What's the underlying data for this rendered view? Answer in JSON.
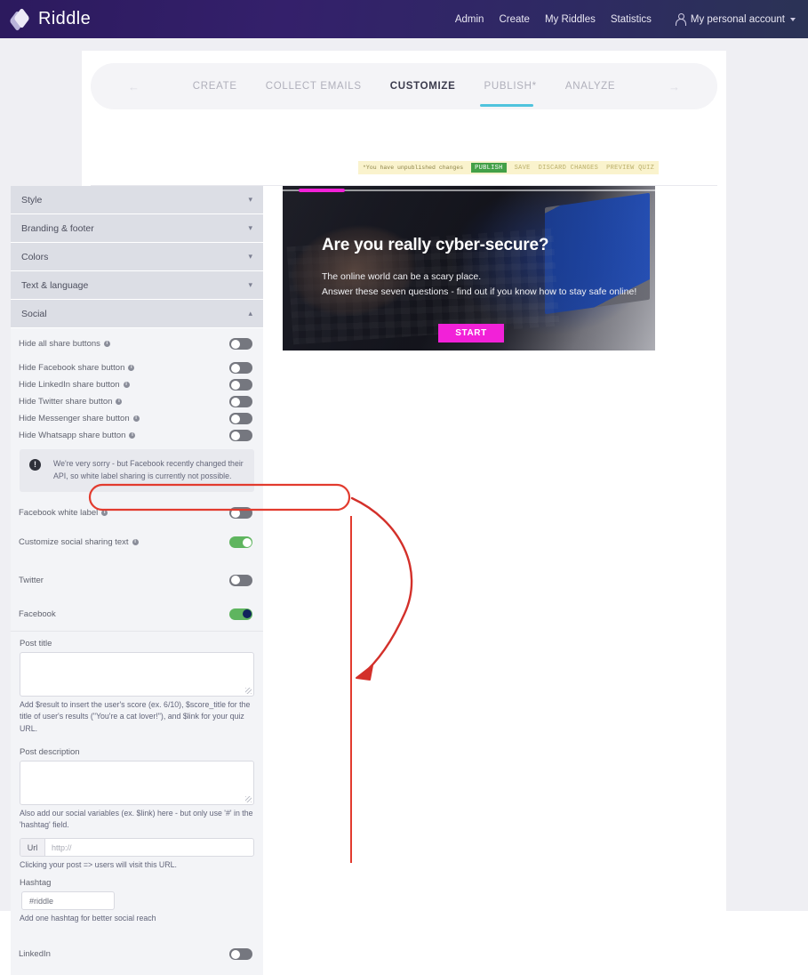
{
  "header": {
    "brand": "Riddle",
    "logo_icon": "riddle-diamond-logo",
    "nav": [
      "Admin",
      "Create",
      "My Riddles",
      "Statistics"
    ],
    "account_label": "My personal account",
    "account_icon": "person-icon",
    "account_caret_icon": "chevron-down-icon"
  },
  "tabs": {
    "prev_icon": "arrow-left-icon",
    "next_icon": "arrow-right-icon",
    "items": [
      {
        "label": "CREATE",
        "active": false
      },
      {
        "label": "COLLECT EMAILS",
        "active": false
      },
      {
        "label": "CUSTOMIZE",
        "active": true
      },
      {
        "label": "PUBLISH*",
        "active": false
      },
      {
        "label": "ANALYZE",
        "active": false
      }
    ],
    "active_underline_color": "#4fc3dd"
  },
  "publish_bar": {
    "warning": "*You have unpublished changes",
    "publish_label": "PUBLISH",
    "publish_color": "#43a047",
    "actions": [
      "SAVE",
      "DISCARD CHANGES",
      "PREVIEW QUIZ"
    ]
  },
  "accordion": [
    {
      "label": "Style",
      "expanded": false,
      "chevron": "chevron-down-icon"
    },
    {
      "label": "Branding & footer",
      "expanded": false,
      "chevron": "chevron-down-icon"
    },
    {
      "label": "Colors",
      "expanded": false,
      "chevron": "chevron-down-icon"
    },
    {
      "label": "Text & language",
      "expanded": false,
      "chevron": "chevron-down-icon"
    },
    {
      "label": "Social",
      "expanded": true,
      "chevron": "chevron-up-icon"
    }
  ],
  "social": {
    "hide_toggles": [
      {
        "label": "Hide all share buttons",
        "on": false,
        "info_icon": "info-icon"
      },
      {
        "label": "Hide Facebook share button",
        "on": false,
        "info_icon": "info-icon"
      },
      {
        "label": "Hide LinkedIn share button",
        "on": false,
        "info_icon": "info-icon"
      },
      {
        "label": "Hide Twitter share button",
        "on": false,
        "info_icon": "info-icon"
      },
      {
        "label": "Hide Messenger share button",
        "on": false,
        "info_icon": "info-icon"
      },
      {
        "label": "Hide Whatsapp share button",
        "on": false,
        "info_icon": "info-icon"
      }
    ],
    "notice": {
      "icon": "exclamation-icon",
      "text": "We're very sorry - but Facebook recently changed their API, so white label sharing is currently not possible."
    },
    "fb_white_label": {
      "label": "Facebook white label",
      "on": false,
      "info_icon": "info-icon"
    },
    "customize_sharing": {
      "label": "Customize social sharing text",
      "on": true,
      "info_icon": "info-icon",
      "highlight_color": "#e23b2e"
    },
    "twitter": {
      "label": "Twitter",
      "on": false
    },
    "facebook": {
      "label": "Facebook",
      "on": true
    },
    "post_title": {
      "label": "Post title",
      "value": "",
      "hint": "Add $result to insert the user's score (ex. 6/10), $score_title for the title of user's results (\"You're a cat lover!\"), and $link for your quiz URL."
    },
    "post_description": {
      "label": "Post description",
      "value": "",
      "hint": "Also add our social variables (ex. $link) here - but only use '#' in the 'hashtag' field."
    },
    "url": {
      "prefix": "Url",
      "placeholder": "http://",
      "value": "",
      "hint": "Clicking your post => users will visit this URL."
    },
    "hashtag": {
      "label": "Hashtag",
      "value": "#riddle",
      "hint": "Add one hashtag for better social reach"
    },
    "linkedin": {
      "label": "LinkedIn",
      "on": false
    }
  },
  "preview": {
    "progress_percent": 13,
    "progress_color": "#f221d8",
    "title": "Are you really cyber-secure?",
    "line1": "The online world can be a scary place.",
    "line2": "Answer these seven questions - find out if you know how to stay safe online!",
    "start_label": "START",
    "start_color": "#f221d8"
  },
  "annotation": {
    "color": "#e23b2e",
    "shapes": [
      "rounded-highlight-box",
      "curved-arrow",
      "vertical-line"
    ]
  }
}
